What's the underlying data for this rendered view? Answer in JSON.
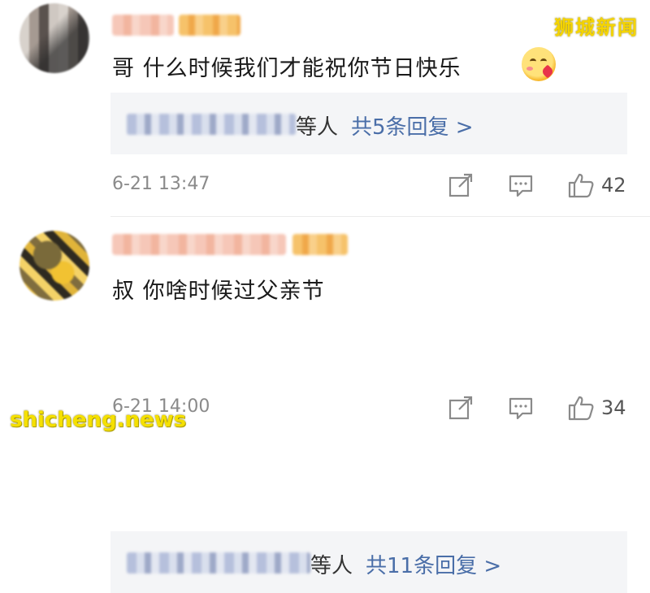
{
  "watermark": {
    "top_right": "狮城新闻",
    "bottom_left": "shicheng.news"
  },
  "comments": [
    {
      "text": "哥 什么时候我们才能祝你节日快乐",
      "emoji_icon": "smiling-face-with-hearts-emoji",
      "reply_suffix": "等人",
      "reply_link": "共5条回复 >",
      "time": "6-21 13:47",
      "likes": "42"
    },
    {
      "text": "叔 你啥时候过父亲节",
      "reply_suffix": "等人",
      "reply_link": "共11条回复 >",
      "time": "6-21 14:00",
      "likes": "34"
    }
  ],
  "icons": {
    "share": "share-icon",
    "comment": "comment-icon",
    "like": "thumbs-up-icon"
  },
  "colors": {
    "link": "#4a6ea8",
    "reply_bg": "#f4f5f7",
    "watermark": "#f5d400"
  }
}
